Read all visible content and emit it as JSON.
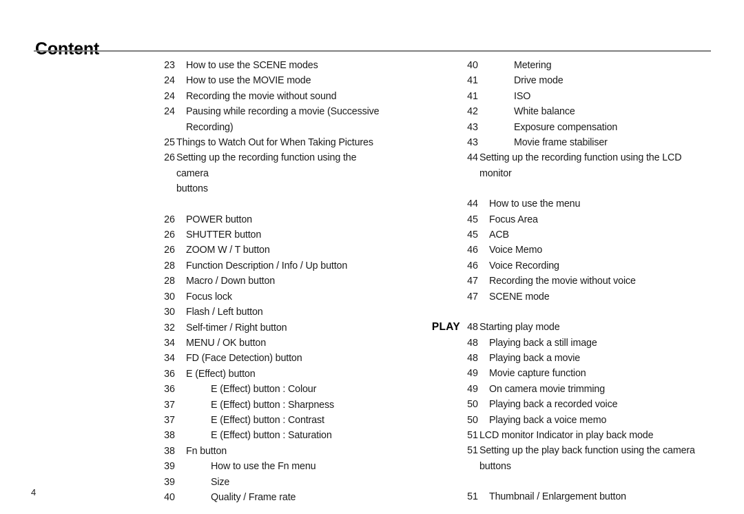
{
  "document": {
    "title": "Content",
    "folio": "4"
  },
  "columns": {
    "left": {
      "entries": [
        {
          "page": "23",
          "text": "How to use the SCENE modes",
          "level": 2,
          "section": ""
        },
        {
          "page": "24",
          "text": "How to use the MOVIE mode",
          "level": 2,
          "section": ""
        },
        {
          "page": "24",
          "text": "Recording the movie without sound",
          "level": 2,
          "section": ""
        },
        {
          "page": "24",
          "text": "Pausing while recording a movie (Successive\nRecording)",
          "level": 2,
          "section": ""
        },
        {
          "page": "25",
          "text": "Things to Watch Out for When Taking Pictures",
          "level": 1,
          "section": ""
        },
        {
          "page": "26",
          "text": "Setting up the recording function using the camera\nbuttons",
          "level": 1,
          "section": ""
        },
        {
          "page": "26",
          "text": "POWER button",
          "level": 2,
          "section": "",
          "gap": true
        },
        {
          "page": "26",
          "text": "SHUTTER button",
          "level": 2,
          "section": ""
        },
        {
          "page": "26",
          "text": "ZOOM W / T button",
          "level": 2,
          "section": ""
        },
        {
          "page": "28",
          "text": "Function Description / Info / Up button",
          "level": 2,
          "section": ""
        },
        {
          "page": "28",
          "text": "Macro / Down button",
          "level": 2,
          "section": ""
        },
        {
          "page": "30",
          "text": "Focus lock",
          "level": 2,
          "section": ""
        },
        {
          "page": "30",
          "text": "Flash / Left button",
          "level": 2,
          "section": ""
        },
        {
          "page": "32",
          "text": "Self-timer / Right button",
          "level": 2,
          "section": ""
        },
        {
          "page": "34",
          "text": "MENU / OK button",
          "level": 2,
          "section": ""
        },
        {
          "page": "34",
          "text": "FD (Face Detection) button",
          "level": 2,
          "section": ""
        },
        {
          "page": "36",
          "text": "E (Effect) button",
          "level": 2,
          "section": ""
        },
        {
          "page": "36",
          "text": "E (Effect) button : Colour",
          "level": 3,
          "section": ""
        },
        {
          "page": "37",
          "text": "E (Effect) button : Sharpness",
          "level": 3,
          "section": ""
        },
        {
          "page": "37",
          "text": "E (Effect) button : Contrast",
          "level": 3,
          "section": ""
        },
        {
          "page": "38",
          "text": "E (Effect) button : Saturation",
          "level": 3,
          "section": ""
        },
        {
          "page": "38",
          "text": "Fn button",
          "level": 2,
          "section": ""
        },
        {
          "page": "39",
          "text": "How to use the Fn menu",
          "level": 3,
          "section": ""
        },
        {
          "page": "39",
          "text": "Size",
          "level": 3,
          "section": ""
        },
        {
          "page": "40",
          "text": "Quality / Frame rate",
          "level": 3,
          "section": ""
        }
      ]
    },
    "right": {
      "entries": [
        {
          "page": "40",
          "text": "Metering",
          "level": 3,
          "section": ""
        },
        {
          "page": "41",
          "text": "Drive mode",
          "level": 3,
          "section": ""
        },
        {
          "page": "41",
          "text": "ISO",
          "level": 3,
          "section": ""
        },
        {
          "page": "42",
          "text": "White balance",
          "level": 3,
          "section": ""
        },
        {
          "page": "43",
          "text": "Exposure compensation",
          "level": 3,
          "section": ""
        },
        {
          "page": "43",
          "text": "Movie frame stabiliser",
          "level": 3,
          "section": ""
        },
        {
          "page": "44",
          "text": "Setting up the recording function using the LCD\nmonitor",
          "level": 1,
          "section": ""
        },
        {
          "page": "44",
          "text": "How to use the menu",
          "level": 2,
          "section": "",
          "gap": true
        },
        {
          "page": "45",
          "text": "Focus Area",
          "level": 2,
          "section": ""
        },
        {
          "page": "45",
          "text": "ACB",
          "level": 2,
          "section": ""
        },
        {
          "page": "46",
          "text": "Voice Memo",
          "level": 2,
          "section": ""
        },
        {
          "page": "46",
          "text": "Voice Recording",
          "level": 2,
          "section": ""
        },
        {
          "page": "47",
          "text": "Recording the movie without voice",
          "level": 2,
          "section": ""
        },
        {
          "page": "47",
          "text": "SCENE mode",
          "level": 2,
          "section": ""
        },
        {
          "page": "48",
          "text": "Starting play mode",
          "level": 1,
          "section": "PLAY",
          "gap": true
        },
        {
          "page": "48",
          "text": "Playing back a still image",
          "level": 2,
          "section": ""
        },
        {
          "page": "48",
          "text": "Playing back a movie",
          "level": 2,
          "section": ""
        },
        {
          "page": "49",
          "text": "Movie capture function",
          "level": 2,
          "section": ""
        },
        {
          "page": "49",
          "text": "On camera movie trimming",
          "level": 2,
          "section": ""
        },
        {
          "page": "50",
          "text": "Playing back a recorded voice",
          "level": 2,
          "section": ""
        },
        {
          "page": "50",
          "text": "Playing back a voice memo",
          "level": 2,
          "section": ""
        },
        {
          "page": "51",
          "text": "LCD monitor Indicator in play back mode",
          "level": 1,
          "section": ""
        },
        {
          "page": "51",
          "text": "Setting up the play back function using the camera\nbuttons",
          "level": 1,
          "section": ""
        },
        {
          "page": "51",
          "text": "Thumbnail / Enlargement button",
          "level": 2,
          "section": "",
          "gap": true
        }
      ]
    }
  }
}
